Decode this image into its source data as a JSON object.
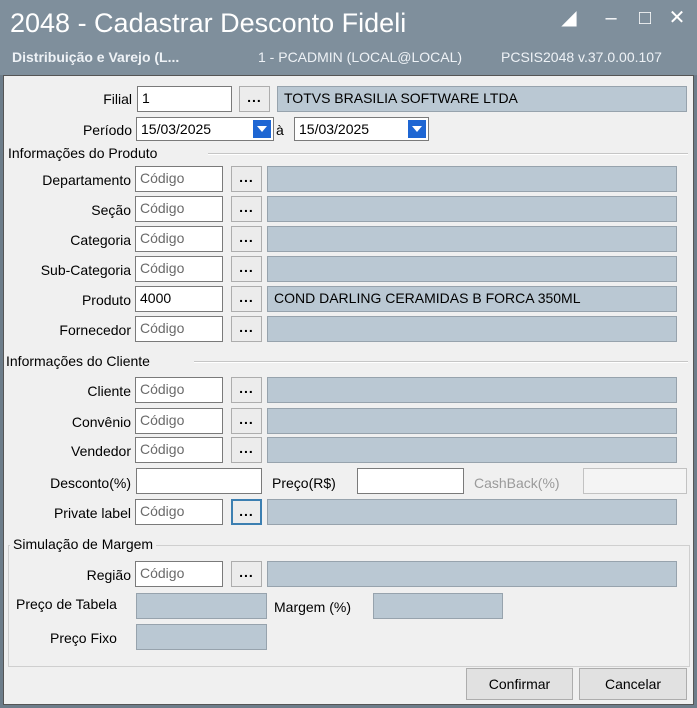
{
  "window": {
    "title": "2048 - Cadastrar Desconto Fideli",
    "subtitle": "Distribuição e Varejo (L...",
    "user_info": "1 - PCADMIN (LOCAL@LOCAL)",
    "program_info": "PCSIS2048  v.37.0.00.107"
  },
  "filial": {
    "label": "Filial",
    "code": "1",
    "name": "TOTVS BRASILIA SOFTWARE LTDA"
  },
  "periodo": {
    "label": "Período",
    "from": "15/03/2025",
    "connector": "à",
    "to": "15/03/2025"
  },
  "produto_section": {
    "title": "Informações do Produto",
    "departamento": {
      "label": "Departamento",
      "code": "Código",
      "name": ""
    },
    "secao": {
      "label": "Seção",
      "code": "Código",
      "name": ""
    },
    "categoria": {
      "label": "Categoria",
      "code": "Código",
      "name": ""
    },
    "subcategoria": {
      "label": "Sub-Categoria",
      "code": "Código",
      "name": ""
    },
    "produto": {
      "label": "Produto",
      "code": "4000",
      "name": "COND DARLING CERAMIDAS B FORCA 350ML"
    },
    "fornecedor": {
      "label": "Fornecedor",
      "code": "Código",
      "name": ""
    }
  },
  "cliente_section": {
    "title": "Informações do Cliente",
    "cliente": {
      "label": "Cliente",
      "code": "Código",
      "name": ""
    },
    "convenio": {
      "label": "Convênio",
      "code": "Código",
      "name": ""
    },
    "vendedor": {
      "label": "Vendedor",
      "code": "Código",
      "name": ""
    },
    "desconto_label": "Desconto(%)",
    "preco_label": "Preço(R$)",
    "cashback_label": "CashBack(%)",
    "private_label": {
      "label": "Private label",
      "code": "Código",
      "name": ""
    }
  },
  "simulacao": {
    "title": "Simulação de Margem",
    "regiao": {
      "label": "Região",
      "code": "Código",
      "name": ""
    },
    "preco_tabela_label": "Preço de Tabela",
    "margem_label": "Margem (%)",
    "preco_fixo_label": "Preço Fixo"
  },
  "lookup_button_label": "...",
  "buttons": {
    "confirm": "Confirmar",
    "cancel": "Cancelar"
  },
  "colors": {
    "title_bg": "#7f8f9c",
    "readonly_bg": "#bac8d3",
    "dropdown_arrow": "#1e66d3"
  }
}
